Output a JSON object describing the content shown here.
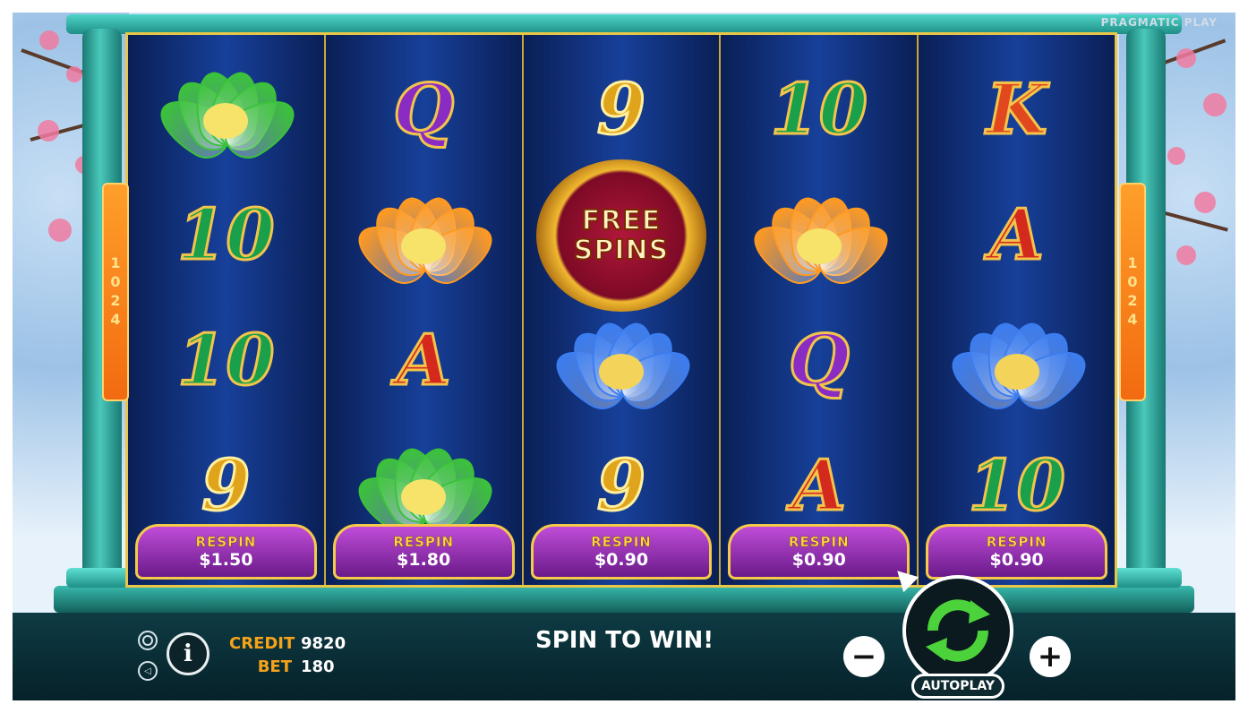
{
  "brand": "PRAGMATIC PLAY",
  "ways": {
    "left": "1024",
    "right": "1024"
  },
  "reels": [
    {
      "symbols": [
        {
          "kind": "lotus-green"
        },
        {
          "kind": "text",
          "text": "10",
          "cls": "sym-ten"
        },
        {
          "kind": "text",
          "text": "10",
          "cls": "sym-ten"
        },
        {
          "kind": "text",
          "text": "9",
          "cls": "sym-nine"
        }
      ],
      "respin": {
        "label": "RESPIN",
        "price": "$1.50"
      }
    },
    {
      "symbols": [
        {
          "kind": "text",
          "text": "Q",
          "cls": "sym-q"
        },
        {
          "kind": "lotus-orange"
        },
        {
          "kind": "text",
          "text": "A",
          "cls": "sym-a"
        },
        {
          "kind": "lotus-green"
        }
      ],
      "respin": {
        "label": "RESPIN",
        "price": "$1.80"
      }
    },
    {
      "symbols": [
        {
          "kind": "text",
          "text": "9",
          "cls": "sym-nine"
        },
        {
          "kind": "free-spins",
          "line1": "FREE",
          "line2": "SPINS"
        },
        {
          "kind": "lotus-blue"
        },
        {
          "kind": "text",
          "text": "9",
          "cls": "sym-nine"
        }
      ],
      "respin": {
        "label": "RESPIN",
        "price": "$0.90"
      }
    },
    {
      "symbols": [
        {
          "kind": "text",
          "text": "10",
          "cls": "sym-ten"
        },
        {
          "kind": "lotus-orange"
        },
        {
          "kind": "text",
          "text": "Q",
          "cls": "sym-q"
        },
        {
          "kind": "text",
          "text": "A",
          "cls": "sym-a"
        }
      ],
      "respin": {
        "label": "RESPIN",
        "price": "$0.90"
      }
    },
    {
      "symbols": [
        {
          "kind": "text",
          "text": "K",
          "cls": "sym-k"
        },
        {
          "kind": "text",
          "text": "A",
          "cls": "sym-a"
        },
        {
          "kind": "lotus-blue"
        },
        {
          "kind": "text",
          "text": "10",
          "cls": "sym-ten"
        }
      ],
      "respin": {
        "label": "RESPIN",
        "price": "$0.90"
      }
    }
  ],
  "status": {
    "credit_label": "CREDIT",
    "credit_value": "9820",
    "bet_label": "BET",
    "bet_value": "180",
    "message": "SPIN TO WIN!"
  },
  "controls": {
    "info_label": "i",
    "minus_label": "−",
    "plus_label": "+",
    "autoplay_label": "AUTOPLAY"
  },
  "colors": {
    "lotus_green": "#3bc23a",
    "lotus_orange": "#ff9a22",
    "lotus_blue": "#3c7df0",
    "reel_bg": "#17409a",
    "frame_teal": "#2fb0a4",
    "spin_green": "#4cd23a"
  }
}
